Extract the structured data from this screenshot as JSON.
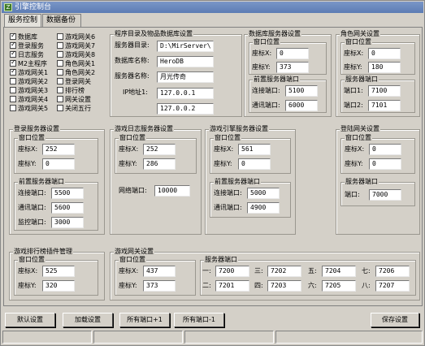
{
  "window": {
    "title": "引擎控制台"
  },
  "tabs": [
    "服务控制",
    "数据备份"
  ],
  "services": [
    {
      "label": "数据库",
      "checked": true
    },
    {
      "label": "登录服务",
      "checked": true
    },
    {
      "label": "日志服务",
      "checked": true
    },
    {
      "label": "M2主程序",
      "checked": true
    },
    {
      "label": "游戏网关1",
      "checked": true
    },
    {
      "label": "游戏网关2",
      "checked": false
    },
    {
      "label": "游戏网关3",
      "checked": false
    },
    {
      "label": "游戏网关4",
      "checked": false
    },
    {
      "label": "游戏网关5",
      "checked": false
    },
    {
      "label": "游戏网关6",
      "checked": false
    },
    {
      "label": "游戏网关7",
      "checked": false
    },
    {
      "label": "游戏网关8",
      "checked": false
    },
    {
      "label": "角色网关1",
      "checked": false
    },
    {
      "label": "角色网关2",
      "checked": false
    },
    {
      "label": "登录网关",
      "checked": false
    },
    {
      "label": "排行榜",
      "checked": false
    },
    {
      "label": "网关设置",
      "checked": false
    },
    {
      "label": "关闭五行",
      "checked": false
    }
  ],
  "program_dir": {
    "title": "程序目录及物品数据库设置",
    "dir_label": "服务器目录:",
    "dir_value": "D:\\MirServer\\",
    "db_label": "数据库名称:",
    "db_value": "HeroDB",
    "server_label": "服务器名称:",
    "server_value": "月光传奇",
    "ip_label": "IP地址1:",
    "ip1": "127.0.0.1",
    "ip2": "127.0.0.2"
  },
  "db_server": {
    "title": "数据库服务器设置",
    "window_pos": "窗口位置",
    "x_label": "座标X:",
    "x": "0",
    "y_label": "座标Y:",
    "y": "373",
    "front": "前置服务器端口",
    "conn_label": "连接端口:",
    "conn": "5100",
    "comm_label": "通讯端口:",
    "comm": "6000"
  },
  "role_gate": {
    "title": "角色网关设置",
    "window_pos": "窗口位置",
    "x_label": "座标X:",
    "x": "0",
    "y_label": "座标Y:",
    "y": "180",
    "ports": "服务器端口",
    "p1_label": "端口1:",
    "p1": "7100",
    "p2_label": "端口2:",
    "p2": "7101"
  },
  "login_server": {
    "title": "登录服务器设置",
    "window_pos": "窗口位置",
    "x_label": "座标X:",
    "x": "252",
    "y_label": "座标Y:",
    "y": "0",
    "front": "前置服务器端口",
    "conn_label": "连接端口:",
    "conn": "5500",
    "comm_label": "通讯端口:",
    "comm": "5600",
    "mon_label": "监控端口:",
    "mon": "3000"
  },
  "log_server": {
    "title": "游戏日志服务器设置",
    "window_pos": "窗口位置",
    "x_label": "座标X:",
    "x": "252",
    "y_label": "座标Y:",
    "y": "286",
    "net_label": "网络端口:",
    "net": "10000"
  },
  "engine_server": {
    "title": "游戏引擎服务器设置",
    "window_pos": "窗口位置",
    "x_label": "座标X:",
    "x": "561",
    "y_label": "座标Y:",
    "y": "0",
    "front": "前置服务器端口",
    "conn_label": "连接端口:",
    "conn": "5000",
    "comm_label": "通讯端口:",
    "comm": "4900"
  },
  "login_gate": {
    "title": "登陆网关设置",
    "window_pos": "窗口位置",
    "x_label": "座标X:",
    "x": "0",
    "y_label": "座标Y:",
    "y": "0",
    "ports": "服务器端口",
    "port_label": "端口:",
    "port": "7000"
  },
  "rank_plugin": {
    "title": "游戏排行榜插件管理",
    "window_pos": "窗口位置",
    "x_label": "座标X:",
    "x": "525",
    "y_label": "座标Y:",
    "y": "320"
  },
  "game_gate": {
    "title": "游戏网关设置",
    "window_pos": "窗口位置",
    "x_label": "座标X:",
    "x": "437",
    "y_label": "座标Y:",
    "y": "373",
    "ports": "服务器端口",
    "slots": [
      {
        "label": "一:",
        "value": "7200"
      },
      {
        "label": "二:",
        "value": "7201"
      },
      {
        "label": "三:",
        "value": "7202"
      },
      {
        "label": "四:",
        "value": "7203"
      },
      {
        "label": "五:",
        "value": "7204"
      },
      {
        "label": "六:",
        "value": "7205"
      },
      {
        "label": "七:",
        "value": "7206"
      },
      {
        "label": "八:",
        "value": "7207"
      }
    ]
  },
  "buttons": {
    "default": "默认设置",
    "load": "加载设置",
    "plus": "所有端口+1",
    "minus": "所有端口-1",
    "save": "保存设置"
  }
}
